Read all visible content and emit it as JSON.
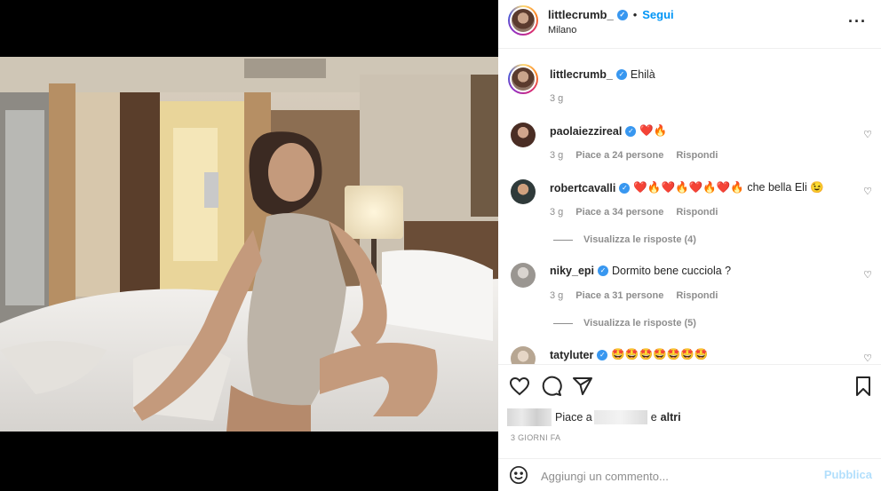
{
  "header": {
    "username": "littlecrumb_",
    "separator": "•",
    "follow_label": "Segui",
    "location": "Milano",
    "more_icon": "more-horizontal-icon"
  },
  "caption": {
    "username": "littlecrumb_",
    "text": "Ehilà",
    "time": "3 g"
  },
  "comments": [
    {
      "username": "paolaiezzireal",
      "text": "❤️🔥",
      "time": "3 g",
      "likes": "Piace a 24 persone",
      "reply": "Rispondi"
    },
    {
      "username": "robertcavalli",
      "text": "❤️🔥❤️🔥❤️🔥❤️🔥 che bella Eli 😉",
      "time": "3 g",
      "likes": "Piace a 34 persone",
      "reply": "Rispondi",
      "view_replies": "Visualizza le risposte (4)"
    },
    {
      "username": "niky_epi",
      "text": "Dormito bene cucciola ?",
      "time": "3 g",
      "likes": "Piace a 31 persone",
      "reply": "Rispondi",
      "view_replies": "Visualizza le risposte (5)"
    },
    {
      "username": "tatyluter",
      "text": "🤩🤩🤩🤩🤩🤩🤩"
    }
  ],
  "likes": {
    "prefix": "Piace a",
    "suffix": "e",
    "others": "altri"
  },
  "date": "3 GIORNI FA",
  "composer": {
    "placeholder": "Aggiungi un commento...",
    "publish_label": "Pubblica"
  },
  "colors": {
    "accent": "#0095f6",
    "verified": "#3897f0",
    "muted": "#8e8e8e",
    "publish_disabled": "#b2dffc"
  }
}
